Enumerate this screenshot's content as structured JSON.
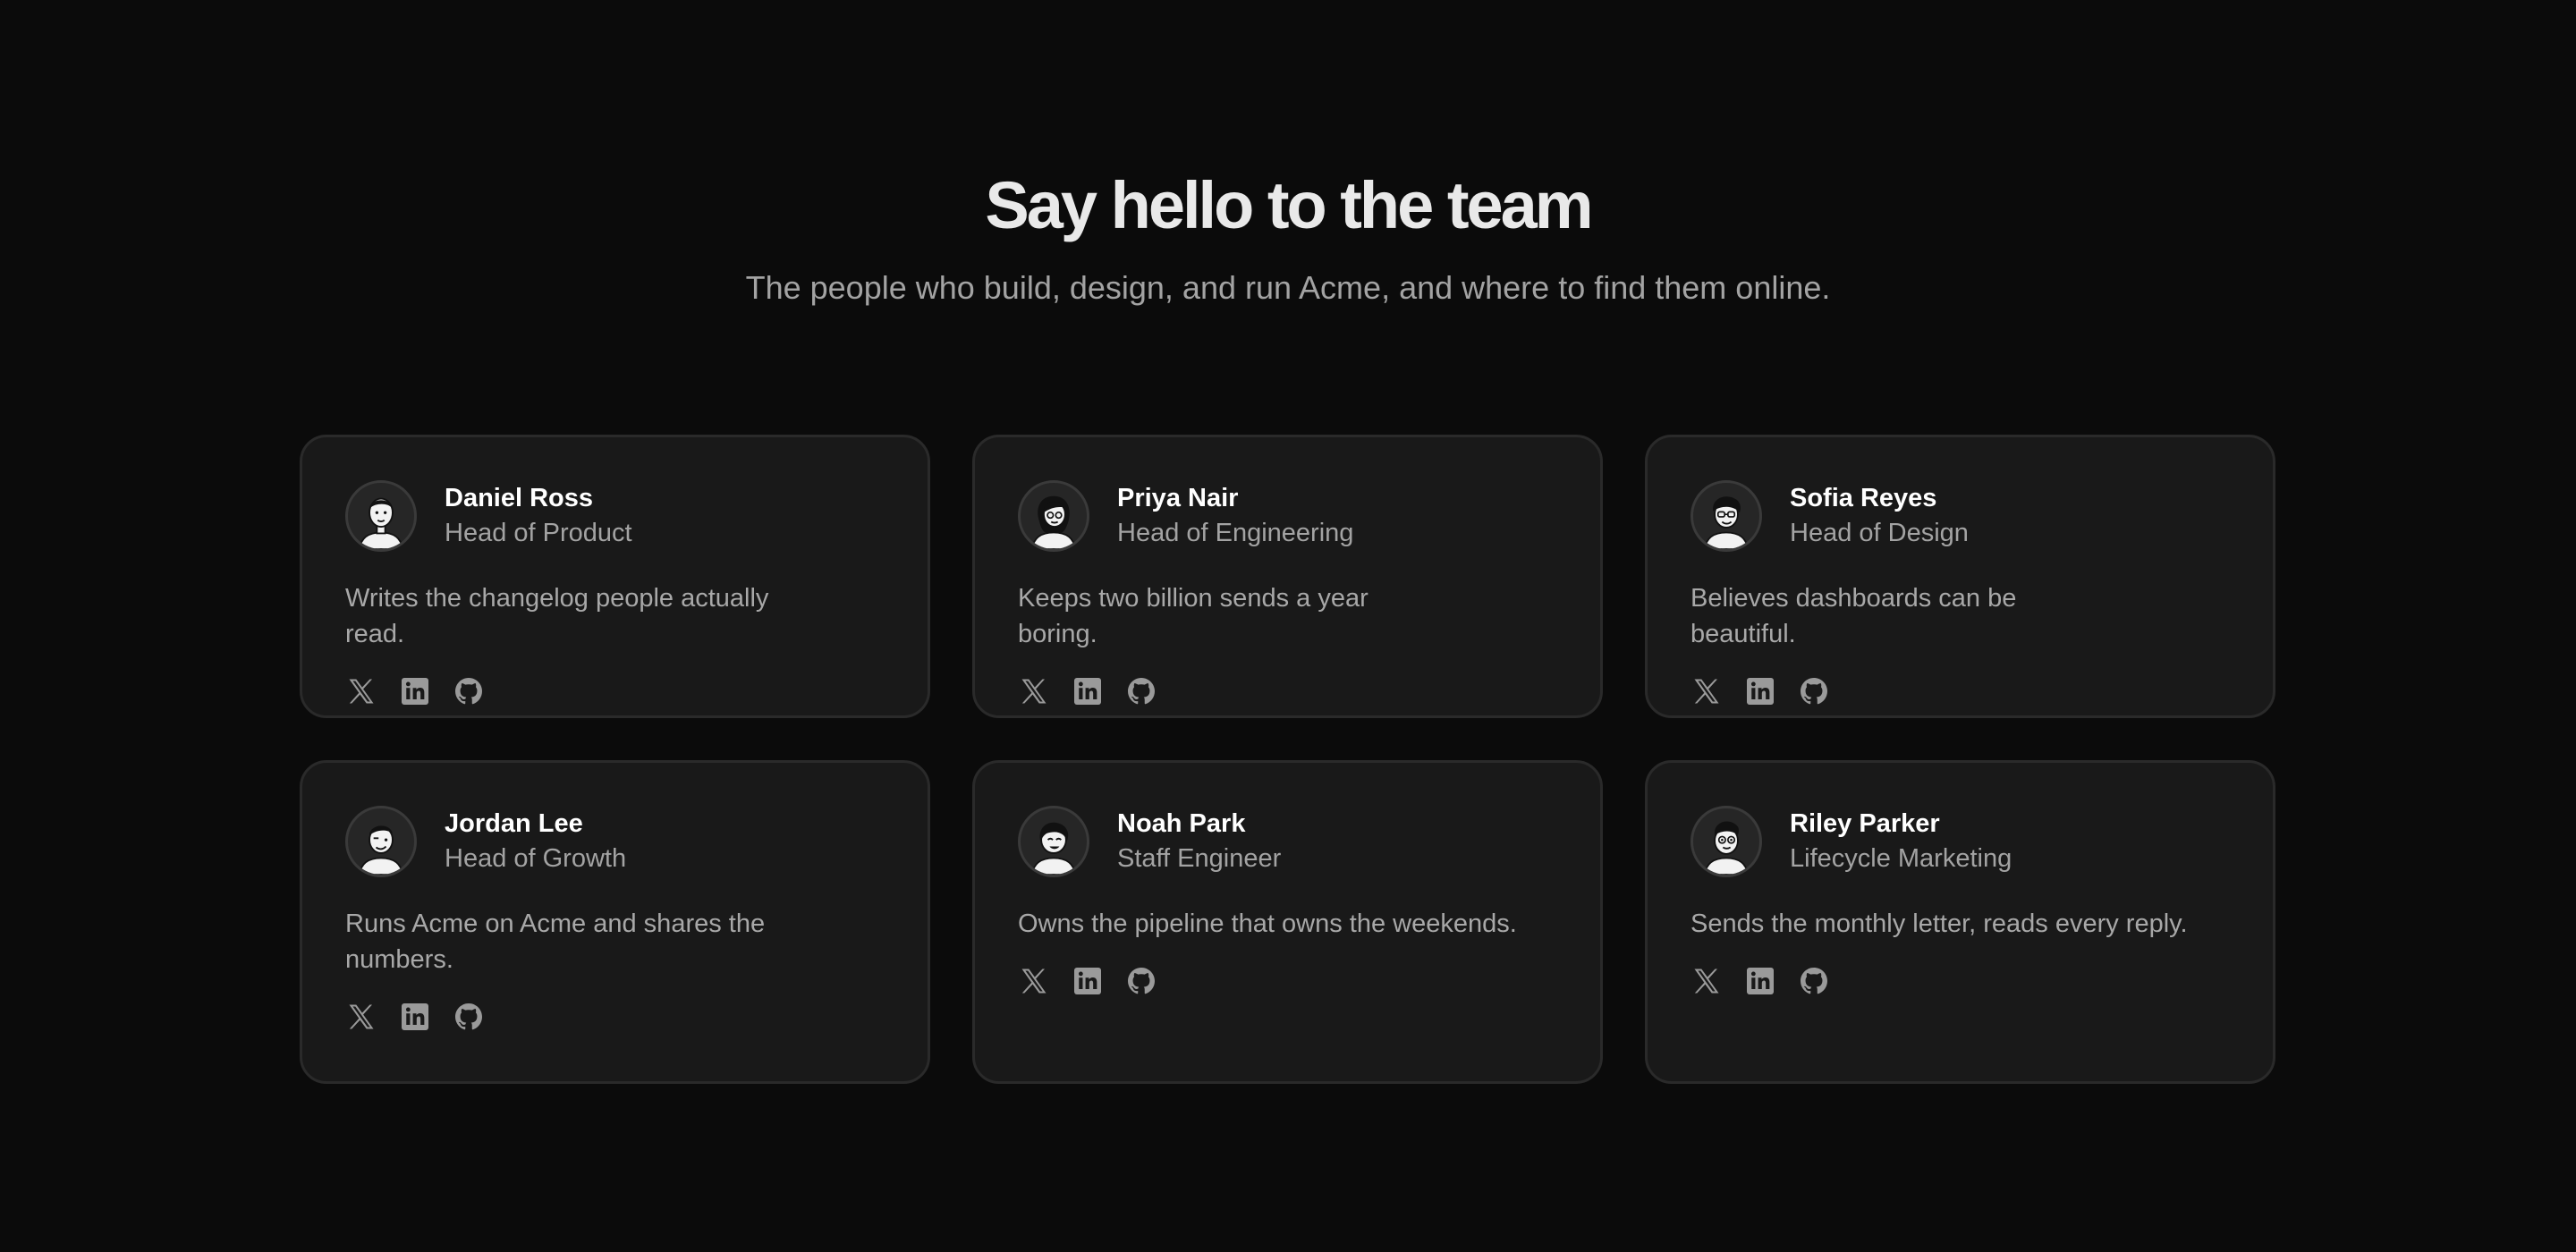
{
  "header": {
    "title": "Say hello to the team",
    "subtitle": "The people who build, design, and run Acme, and where to find them online."
  },
  "icons": {
    "x": "x-icon",
    "linkedin": "linkedin-icon",
    "github": "github-icon"
  },
  "colors": {
    "background": "#0b0b0b",
    "card": "#191919",
    "card_border": "#2a2a2a",
    "muted_text": "#a3a3a3",
    "icon": "#9a9a9a"
  },
  "team": [
    {
      "name": "Daniel Ross",
      "role": "Head of Product",
      "bio": "Writes the changelog people actually read."
    },
    {
      "name": "Priya Nair",
      "role": "Head of Engineering",
      "bio": "Keeps two billion sends a year boring."
    },
    {
      "name": "Sofia Reyes",
      "role": "Head of Design",
      "bio": "Believes dashboards can be beautiful."
    },
    {
      "name": "Jordan Lee",
      "role": "Head of Growth",
      "bio": "Runs Acme on Acme and shares the numbers."
    },
    {
      "name": "Noah Park",
      "role": "Staff Engineer",
      "bio": "Owns the pipeline that owns the weekends."
    },
    {
      "name": "Riley Parker",
      "role": "Lifecycle Marketing",
      "bio": "Sends the monthly letter, reads every reply."
    }
  ]
}
